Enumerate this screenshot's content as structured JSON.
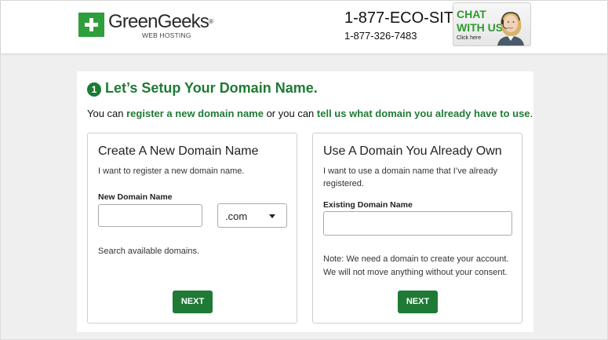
{
  "header": {
    "logo": {
      "name": "GreenGeeks",
      "trademark": "®",
      "subtitle": "WEB HOSTING"
    },
    "phone_primary": "1-877-ECO-SITE",
    "phone_secondary": "1-877-326-7483",
    "chat": {
      "line1": "CHAT",
      "line2": "WITH US",
      "small": "Click here"
    }
  },
  "step": {
    "number": "1",
    "title": "Let’s Setup Your Domain Name.",
    "intro_before": "You can ",
    "intro_link1": "register a new domain name",
    "intro_middle": " or you can ",
    "intro_link2": "tell us what domain you already have to use",
    "intro_after": "."
  },
  "new_domain": {
    "title": "Create A New Domain Name",
    "description": "I want to register a new domain name.",
    "field_label": "New Domain Name",
    "input_value": "",
    "tld_selected": ".com",
    "search_text": "Search available domains.",
    "next_label": "NEXT"
  },
  "existing_domain": {
    "title": "Use A Domain You Already Own",
    "description": "I want to use a domain name that I’ve already registered.",
    "field_label": "Existing Domain Name",
    "input_value": "",
    "note": "Note: We need a domain to create your account. We will not move anything without your consent.",
    "next_label": "NEXT"
  },
  "colors": {
    "brand_green": "#1f7a35",
    "logo_green": "#2f9e3c",
    "chat_green": "#2e9a2e",
    "page_bg": "#efefef"
  },
  "icons": {
    "logo": "plus-icon",
    "dropdown": "chevron-down-icon",
    "agent": "support-agent-icon"
  }
}
